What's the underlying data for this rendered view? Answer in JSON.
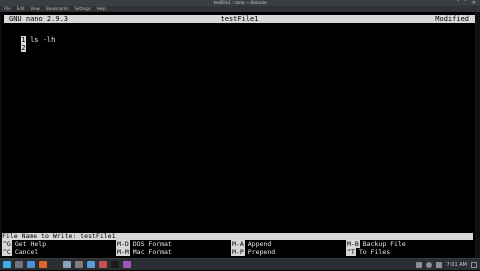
{
  "window": {
    "title": "testFile1 : nano — Konsole",
    "controls": [
      "˅",
      "˄",
      "✕"
    ]
  },
  "menubar": [
    "File",
    "Edit",
    "View",
    "Bookmarks",
    "Settings",
    "Help"
  ],
  "nano": {
    "version": "GNU nano 2.9.3",
    "filename": "testFile1",
    "status": "Modified",
    "lines": [
      {
        "num": "1",
        "text": "ls -lh"
      },
      {
        "num": "2",
        "text": ""
      }
    ],
    "prompt": "File Name to Write: testFile1",
    "shortcuts": [
      {
        "key": "^G",
        "label": "Get Help"
      },
      {
        "key": "M-D",
        "label": "DOS Format"
      },
      {
        "key": "M-A",
        "label": "Append"
      },
      {
        "key": "M-B",
        "label": "Backup File"
      },
      {
        "key": "^C",
        "label": "Cancel"
      },
      {
        "key": "M-M",
        "label": "Mac Format"
      },
      {
        "key": "M-P",
        "label": "Prepend"
      },
      {
        "key": "^T",
        "label": "To Files"
      }
    ]
  },
  "taskbar": {
    "apps": [
      {
        "icon": "app-launcher-icon",
        "color": "#3daee9"
      },
      {
        "icon": "desktop-icon",
        "color": "#6d7580"
      },
      {
        "icon": "files-icon",
        "color": "#4f8fd6"
      },
      {
        "icon": "browser-icon",
        "color": "#e0652b"
      },
      {
        "icon": "terminal-icon",
        "color": "#2d2d2d"
      },
      {
        "icon": "text-editor-icon",
        "color": "#8fa3b8"
      },
      {
        "icon": "settings-icon",
        "color": "#7a7f86"
      },
      {
        "icon": "app-icon",
        "color": "#5b9bd5"
      },
      {
        "icon": "app-icon",
        "color": "#c94f4f"
      },
      {
        "icon": "terminal-icon",
        "color": "#1a1a1a"
      },
      {
        "icon": "app-icon",
        "color": "#9a59b5"
      }
    ],
    "clock": "7:01 AM"
  }
}
